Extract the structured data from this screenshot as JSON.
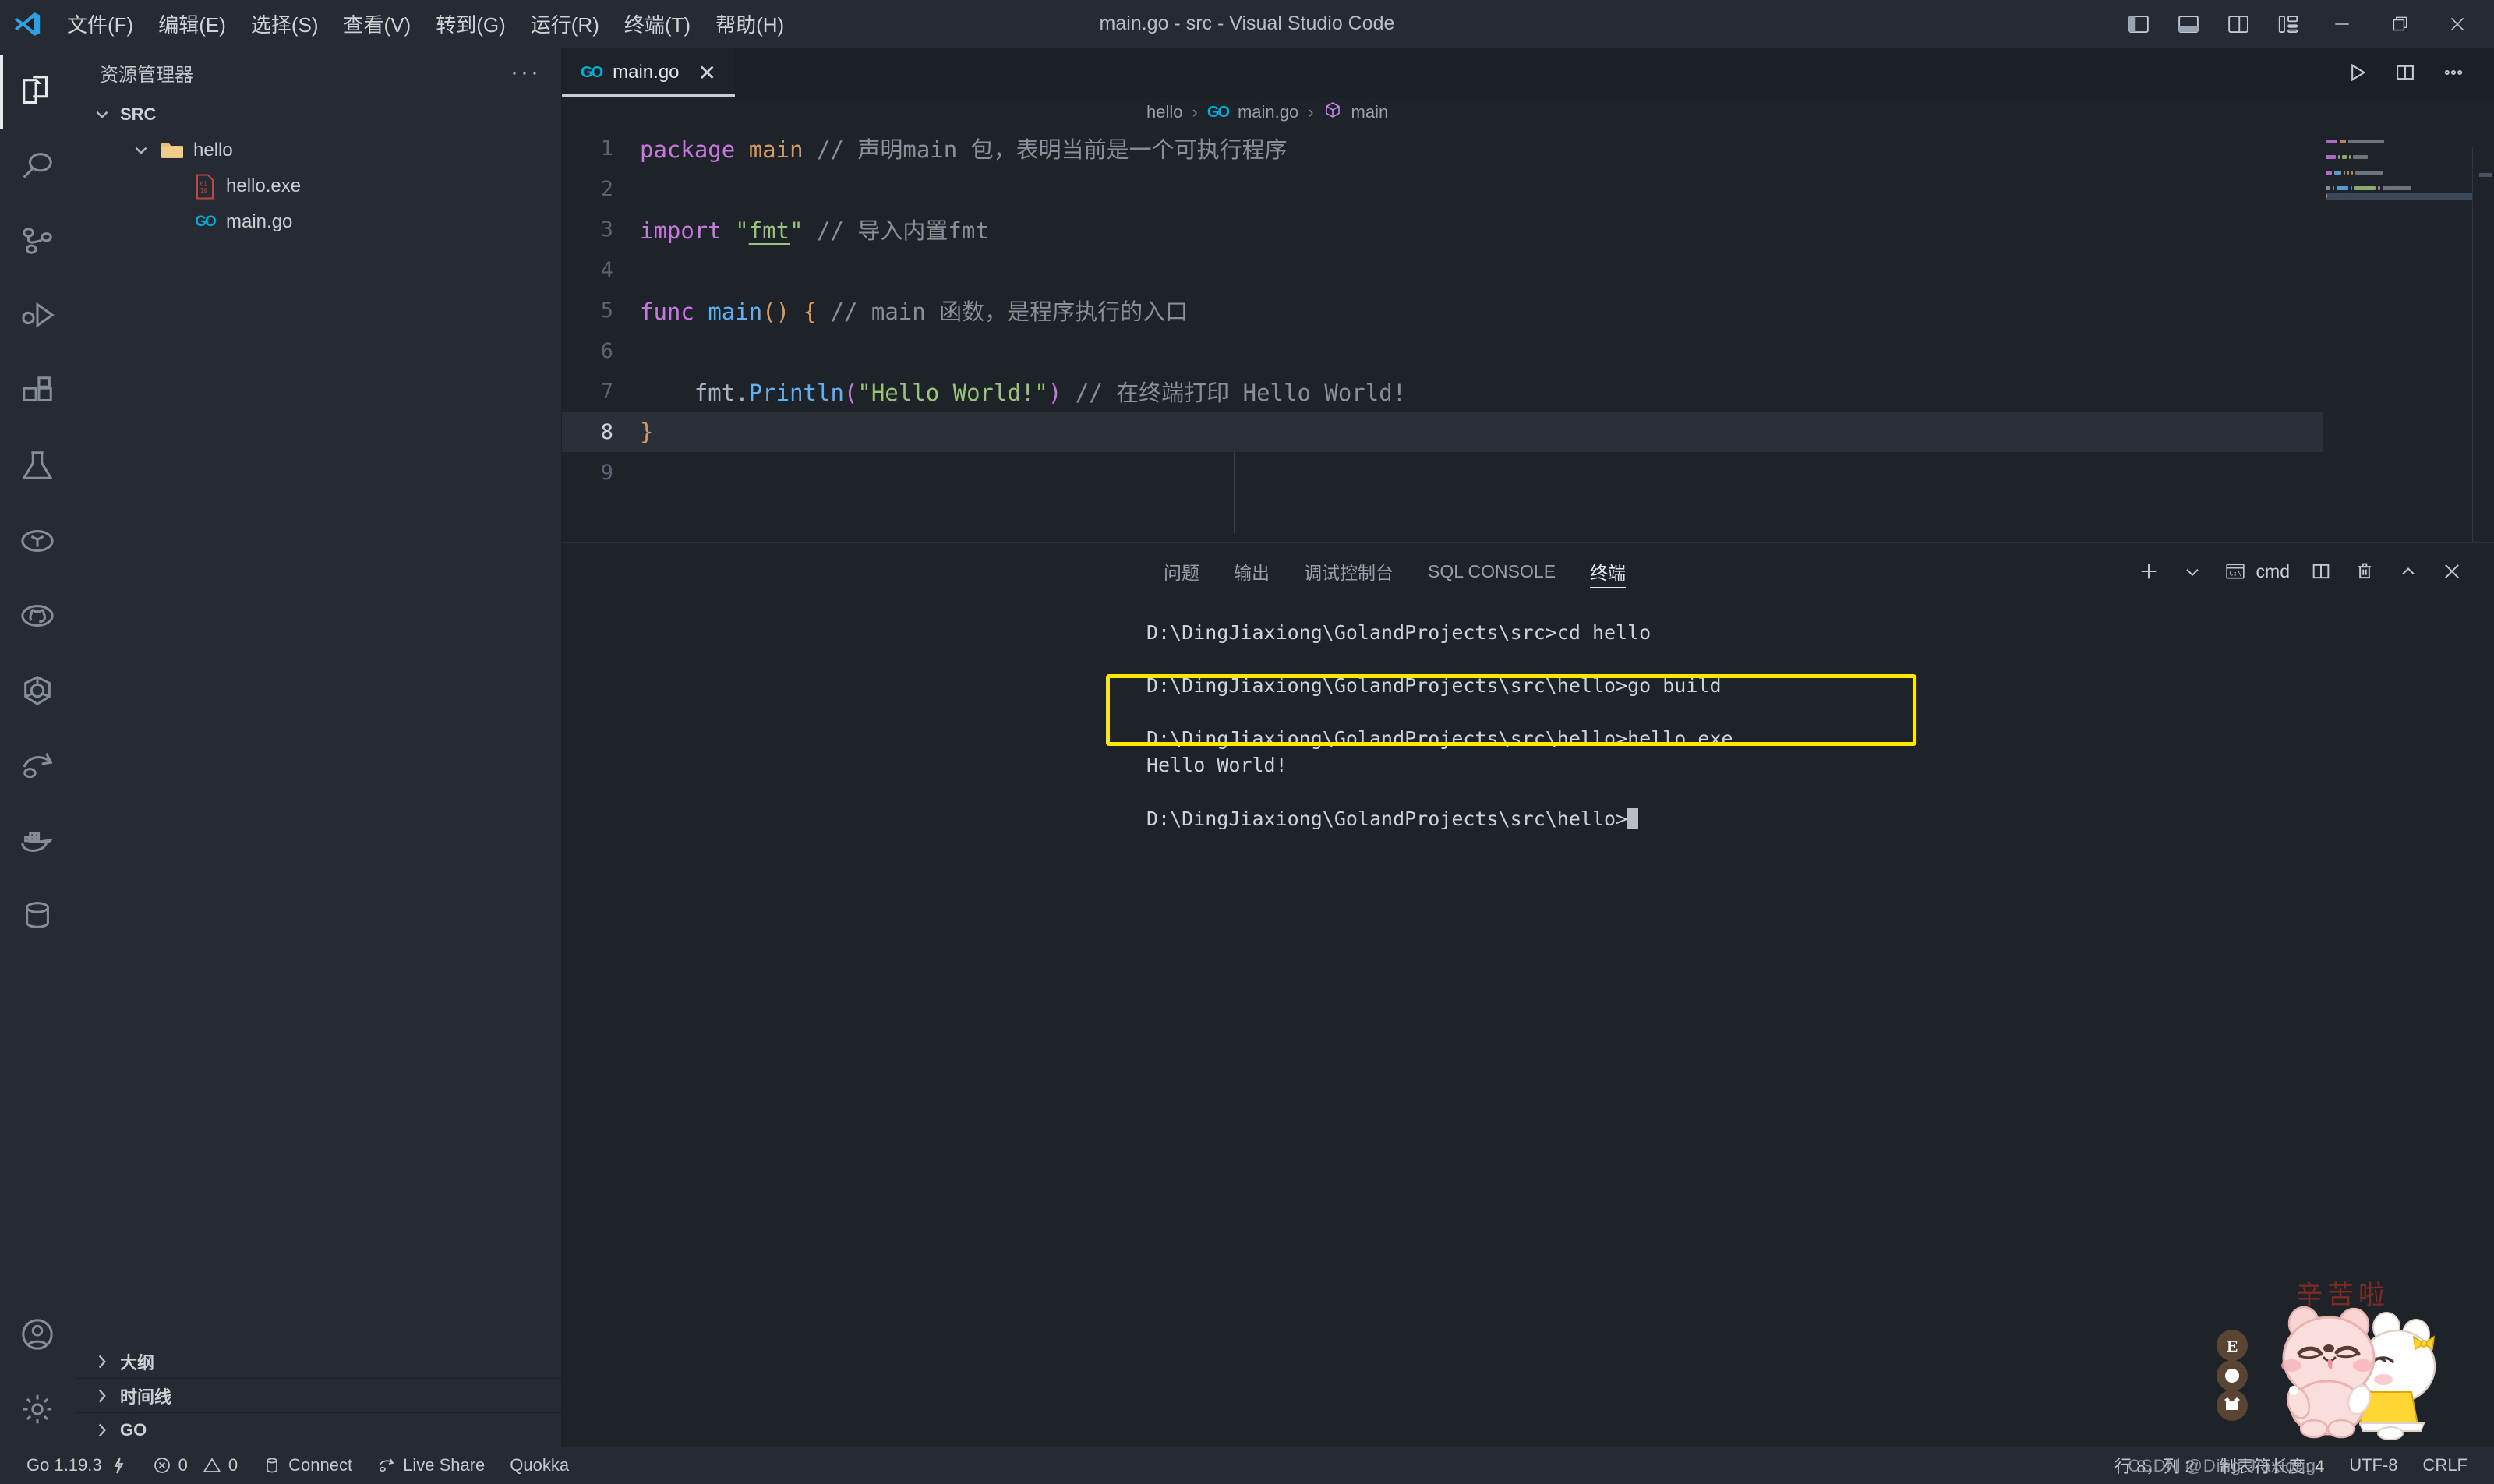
{
  "window": {
    "title": "main.go - src - Visual Studio Code",
    "logo_icon": "vscode-logo"
  },
  "menubar": {
    "items": [
      {
        "label": "文件(F)",
        "name": "menu-file"
      },
      {
        "label": "编辑(E)",
        "name": "menu-edit"
      },
      {
        "label": "选择(S)",
        "name": "menu-selection"
      },
      {
        "label": "查看(V)",
        "name": "menu-view"
      },
      {
        "label": "转到(G)",
        "name": "menu-go"
      },
      {
        "label": "运行(R)",
        "name": "menu-run"
      },
      {
        "label": "终端(T)",
        "name": "menu-terminal"
      },
      {
        "label": "帮助(H)",
        "name": "menu-help"
      }
    ]
  },
  "titlebar_actions": {
    "icons": [
      "toggle-primary-sidebar-icon",
      "toggle-panel-icon",
      "toggle-secondary-sidebar-icon",
      "customize-layout-icon"
    ],
    "window_controls": [
      "minimize-icon",
      "restore-icon",
      "close-icon"
    ]
  },
  "activitybar": {
    "items": [
      {
        "name": "activity-explorer",
        "icon": "files-icon",
        "active": true
      },
      {
        "name": "activity-search",
        "icon": "search-icon",
        "active": false
      },
      {
        "name": "activity-source-control",
        "icon": "source-control-icon",
        "active": false
      },
      {
        "name": "activity-run-debug",
        "icon": "run-and-debug-icon",
        "active": false
      },
      {
        "name": "activity-extensions",
        "icon": "extensions-icon",
        "active": false
      },
      {
        "name": "activity-testing",
        "icon": "beaker-icon",
        "active": false
      },
      {
        "name": "activity-dependency-analytics",
        "icon": "scale-icon",
        "active": false
      },
      {
        "name": "activity-github",
        "icon": "github-icon",
        "active": false
      },
      {
        "name": "activity-kubernetes",
        "icon": "kubernetes-icon",
        "active": false
      },
      {
        "name": "activity-live-share",
        "icon": "live-share-icon",
        "active": false
      },
      {
        "name": "activity-docker",
        "icon": "docker-icon",
        "active": false
      },
      {
        "name": "activity-database",
        "icon": "database-icon",
        "active": false
      }
    ],
    "bottom_items": [
      {
        "name": "activity-accounts",
        "icon": "account-icon"
      },
      {
        "name": "activity-settings",
        "icon": "gear-icon"
      }
    ]
  },
  "sidebar": {
    "title": "资源管理器",
    "more_actions_icon": "ellipsis-icon",
    "root": {
      "label": "SRC",
      "expanded": true
    },
    "tree": [
      {
        "label": "hello",
        "icon": "folder-icon",
        "depth": 1,
        "expanded": true,
        "name": "tree-item-hello"
      },
      {
        "label": "hello.exe",
        "icon": "binary-file-icon",
        "depth": 2,
        "name": "tree-item-hello-exe"
      },
      {
        "label": "main.go",
        "icon": "go-file-icon",
        "depth": 2,
        "name": "tree-item-main-go"
      }
    ],
    "sections": [
      {
        "label": "大纲",
        "name": "sidebar-section-outline"
      },
      {
        "label": "时间线",
        "name": "sidebar-section-timeline"
      },
      {
        "label": "GO",
        "name": "sidebar-section-go"
      }
    ]
  },
  "editor": {
    "tabs": [
      {
        "label": "main.go",
        "icon": "go-file-icon",
        "active": true,
        "close_icon": "close-icon"
      }
    ],
    "tab_actions": [
      "run-code-icon",
      "split-editor-icon",
      "more-actions-icon"
    ],
    "breadcrumb": [
      {
        "label": "hello",
        "icon": ""
      },
      {
        "label": "main.go",
        "icon": "go-file-icon"
      },
      {
        "label": "main",
        "icon": "symbol-package-icon"
      }
    ],
    "breadcrumb_separator": "›",
    "lines": [
      {
        "n": 1,
        "tokens": [
          {
            "t": "package",
            "c": "kw"
          },
          {
            "t": " ",
            "c": "plain"
          },
          {
            "t": "main",
            "c": "kw2"
          },
          {
            "t": " ",
            "c": "plain"
          },
          {
            "t": "// 声明main 包，表明当前是一个可执行程序",
            "c": "cmt"
          }
        ]
      },
      {
        "n": 2,
        "tokens": []
      },
      {
        "n": 3,
        "tokens": [
          {
            "t": "import",
            "c": "kw"
          },
          {
            "t": " ",
            "c": "plain"
          },
          {
            "t": "\"",
            "c": "str"
          },
          {
            "t": "fmt",
            "c": "str uline"
          },
          {
            "t": "\"",
            "c": "str"
          },
          {
            "t": " ",
            "c": "plain"
          },
          {
            "t": "// 导入内置fmt",
            "c": "cmt"
          }
        ]
      },
      {
        "n": 4,
        "tokens": []
      },
      {
        "n": 5,
        "tokens": [
          {
            "t": "func",
            "c": "kw"
          },
          {
            "t": " ",
            "c": "plain"
          },
          {
            "t": "main",
            "c": "fn"
          },
          {
            "t": "(",
            "c": "pn"
          },
          {
            "t": ")",
            "c": "pn"
          },
          {
            "t": " ",
            "c": "plain"
          },
          {
            "t": "{",
            "c": "pn"
          },
          {
            "t": " ",
            "c": "plain"
          },
          {
            "t": "// main 函数，是程序执行的入口",
            "c": "cmt"
          }
        ]
      },
      {
        "n": 6,
        "tokens": []
      },
      {
        "n": 7,
        "tokens": [
          {
            "t": "    ",
            "c": "plain"
          },
          {
            "t": "fmt",
            "c": "plain"
          },
          {
            "t": ".",
            "c": "plain"
          },
          {
            "t": "Println",
            "c": "fn"
          },
          {
            "t": "(",
            "c": "pn2"
          },
          {
            "t": "\"Hello World!\"",
            "c": "str"
          },
          {
            "t": ")",
            "c": "pn2"
          },
          {
            "t": " ",
            "c": "plain"
          },
          {
            "t": "// 在终端打印 Hello World!",
            "c": "cmt"
          }
        ]
      },
      {
        "n": 8,
        "tokens": [
          {
            "t": "}",
            "c": "pn"
          }
        ],
        "current": true
      },
      {
        "n": 9,
        "tokens": []
      }
    ]
  },
  "panel": {
    "tabs": [
      {
        "label": "问题",
        "active": false,
        "name": "panel-tab-problems"
      },
      {
        "label": "输出",
        "active": false,
        "name": "panel-tab-output"
      },
      {
        "label": "调试控制台",
        "active": false,
        "name": "panel-tab-debug-console"
      },
      {
        "label": "SQL CONSOLE",
        "active": false,
        "name": "panel-tab-sql-console"
      },
      {
        "label": "终端",
        "active": true,
        "name": "panel-tab-terminal"
      }
    ],
    "actions": {
      "new_terminal_icon": "plus-icon",
      "new_terminal_dropdown_icon": "chevron-down-icon",
      "shell_icon": "cmd-prompt-icon",
      "shell_label": "cmd",
      "split_icon": "split-terminal-icon",
      "kill_icon": "trash-icon",
      "maximize_icon": "chevron-up-icon",
      "close_icon": "close-icon"
    },
    "terminal": {
      "lines": [
        {
          "text": "D:\\DingJiaxiong\\GolandProjects\\src>cd hello",
          "highlight": false
        },
        {
          "text": "",
          "highlight": false
        },
        {
          "text": "D:\\DingJiaxiong\\GolandProjects\\src\\hello>go build",
          "highlight": false
        },
        {
          "text": "",
          "highlight": false
        },
        {
          "text": "D:\\DingJiaxiong\\GolandProjects\\src\\hello>hello.exe",
          "highlight": true
        },
        {
          "text": "Hello World!",
          "highlight": true
        },
        {
          "text": "",
          "highlight": false
        },
        {
          "text": "D:\\DingJiaxiong\\GolandProjects\\src\\hello>",
          "highlight": false,
          "cursor": true
        }
      ],
      "highlight_color": "#ffe800"
    }
  },
  "statusbar": {
    "left": [
      {
        "label": "Go 1.19.3",
        "icon": "lightning-icon",
        "name": "status-go-version"
      },
      {
        "label": "0",
        "icon": "error-icon",
        "label2": "0",
        "icon2": "warning-icon",
        "name": "status-problems"
      },
      {
        "label": "Connect",
        "icon": "database-icon",
        "name": "status-connect"
      },
      {
        "label": "Live Share",
        "icon": "live-share-icon",
        "name": "status-live-share"
      },
      {
        "label": "Quokka",
        "icon": "",
        "name": "status-quokka"
      }
    ],
    "right": [
      {
        "label": "行 8，列 2",
        "name": "status-cursor-position"
      },
      {
        "label": "制表符长度: 4",
        "name": "status-indentation"
      },
      {
        "label": "UTF-8",
        "name": "status-encoding"
      },
      {
        "label": "CRLF",
        "name": "status-eol"
      }
    ]
  },
  "watermark": {
    "csdn": "CSDN @Ding Jiaxiong",
    "sticker_text": "辛苦啦"
  }
}
